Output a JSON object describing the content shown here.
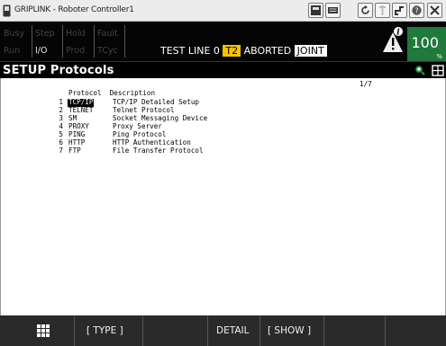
{
  "window": {
    "title": "GRIPLINK - Roboter Controller1",
    "app_icon": "pendant-icon",
    "buttons": [
      "teach-pendant-icon",
      "keyboard-icon",
      "refresh-icon",
      "gripper-icon",
      "robot-arm-icon",
      "help-icon",
      "close-icon"
    ]
  },
  "status": {
    "lamps_row1": [
      "Busy",
      "Step",
      "Hold",
      "Fault"
    ],
    "lamps_row2": [
      "Run",
      "I/O",
      "Prod",
      "TCyc"
    ],
    "line_prefix": "TEST LINE 0",
    "mode": "T2",
    "state": "ABORTED",
    "coord": "JOINT",
    "override_value": "100",
    "override_unit": "%",
    "colors": {
      "mode_bg": "#f3c400",
      "override_bg": "#1f7a3c",
      "lamp_dim": "#3a4a3a"
    }
  },
  "header": {
    "title": "SETUP Protocols",
    "icons": [
      "zoom-icon",
      "split-screen-icon"
    ]
  },
  "content": {
    "page_indicator": "1/7",
    "columns": {
      "protocol": "Protocol",
      "description": "Description"
    },
    "rows": [
      {
        "num": "1",
        "name": "TCP/IP",
        "desc": "TCP/IP Detailed Setup"
      },
      {
        "num": "2",
        "name": "TELNET",
        "desc": "Telnet Protocol"
      },
      {
        "num": "3",
        "name": "SM",
        "desc": "Socket Messaging Device"
      },
      {
        "num": "4",
        "name": "PROXY",
        "desc": "Proxy Server"
      },
      {
        "num": "5",
        "name": "PING",
        "desc": "Ping Protocol"
      },
      {
        "num": "6",
        "name": "HTTP",
        "desc": "HTTP Authentication"
      },
      {
        "num": "7",
        "name": "FTP",
        "desc": "File Transfer Protocol"
      }
    ],
    "selected_row": 1
  },
  "funcbar": {
    "menu_icon": "grid-icon",
    "f1": "[ TYPE ]",
    "f2": "",
    "f3": "DETAIL",
    "f4": "[ SHOW ]",
    "f5": ""
  }
}
